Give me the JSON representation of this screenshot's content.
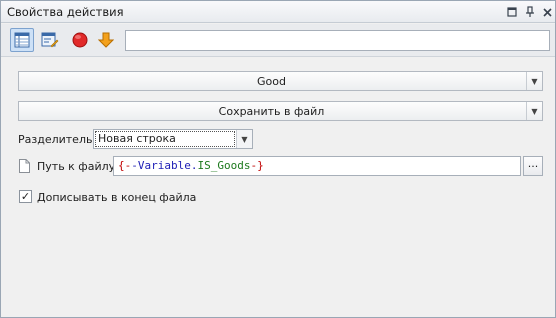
{
  "window": {
    "title": "Свойства действия",
    "buttons": {
      "pin_label": "□",
      "dock_label": "⊥",
      "close_label": "✕"
    }
  },
  "toolbar": {
    "tools": [
      {
        "icon": "table-list-icon",
        "active": true
      },
      {
        "icon": "window-edit-icon",
        "active": false
      },
      {
        "icon": "red-circle-icon",
        "active": false
      },
      {
        "icon": "orange-down-arrow-icon",
        "active": false
      }
    ],
    "input_value": ""
  },
  "form": {
    "variable_combo": {
      "value": "Good"
    },
    "action_combo": {
      "value": "Сохранить в файл"
    },
    "separator": {
      "label": "Разделитель:",
      "value": "Новая строка"
    },
    "file_path": {
      "label": "Путь к файлу",
      "brace_open": "{",
      "prefix": "-Variable.",
      "name": "IS_Goods",
      "suffix": "-",
      "brace_close": "}",
      "browse_label": "..."
    },
    "append": {
      "label": "Дописывать в конец файла",
      "checked": true
    }
  },
  "colors": {
    "brace": "#c00000",
    "var_prefix": "#1d1db5",
    "var_name": "#1e7a1e",
    "accent_active": "#cde1f7"
  }
}
